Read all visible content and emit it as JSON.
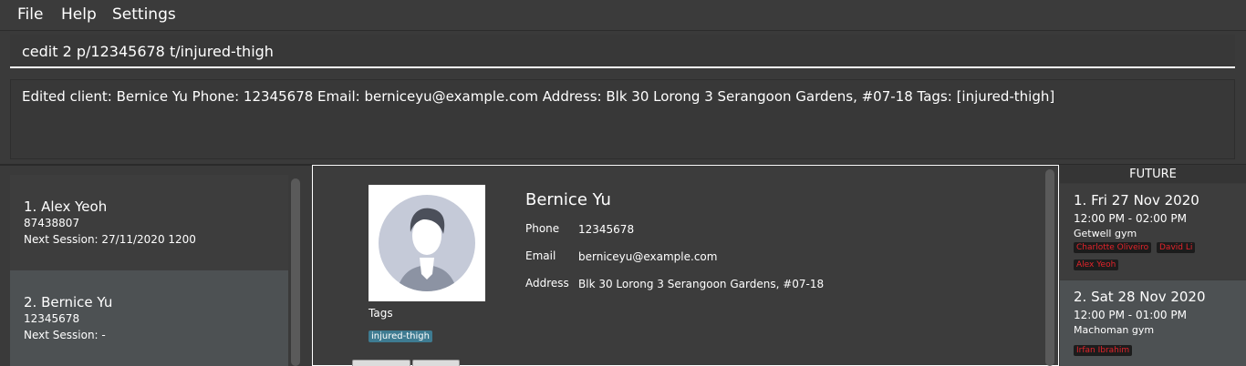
{
  "menu": {
    "file": "File",
    "help": "Help",
    "settings": "Settings"
  },
  "command": {
    "value": "cedit 2 p/12345678 t/injured-thigh"
  },
  "result": {
    "text": "Edited client: Bernice Yu Phone: 12345678 Email: berniceyu@example.com Address: Blk 30 Lorong 3 Serangoon Gardens, #07-18 Tags: [injured-thigh]"
  },
  "clients": [
    {
      "title": "1.  Alex Yeoh",
      "phone": "87438807",
      "session": "Next Session: 27/11/2020 1200"
    },
    {
      "title": "2.  Bernice Yu",
      "phone": "12345678",
      "session": "Next Session:  -"
    }
  ],
  "detail": {
    "name": "Bernice Yu",
    "phone_label": "Phone",
    "phone": "12345678",
    "email_label": "Email",
    "email": "berniceyu@example.com",
    "address_label": "Address",
    "address": "Blk 30 Lorong 3 Serangoon Gardens, #07-18",
    "tags_label": "Tags",
    "tags": [
      "injured-thigh"
    ]
  },
  "future": {
    "header": "FUTURE",
    "sessions": [
      {
        "title": "1.  Fri 27 Nov 2020",
        "time": "12:00 PM - 02:00 PM",
        "gym": "Getwell gym",
        "clients": [
          "Charlotte Oliveiro",
          "David Li",
          "Alex Yeoh"
        ]
      },
      {
        "title": "2.  Sat 28 Nov 2020",
        "time": "12:00 PM - 01:00 PM",
        "gym": "Machoman gym",
        "clients": [
          "Irfan Ibrahim"
        ]
      }
    ]
  },
  "colors": {
    "tag": "#3e7b91",
    "session_client_text": "#e3242b",
    "selected_card": "#4d5153"
  },
  "icons": {
    "avatar": "default-avatar-icon"
  }
}
